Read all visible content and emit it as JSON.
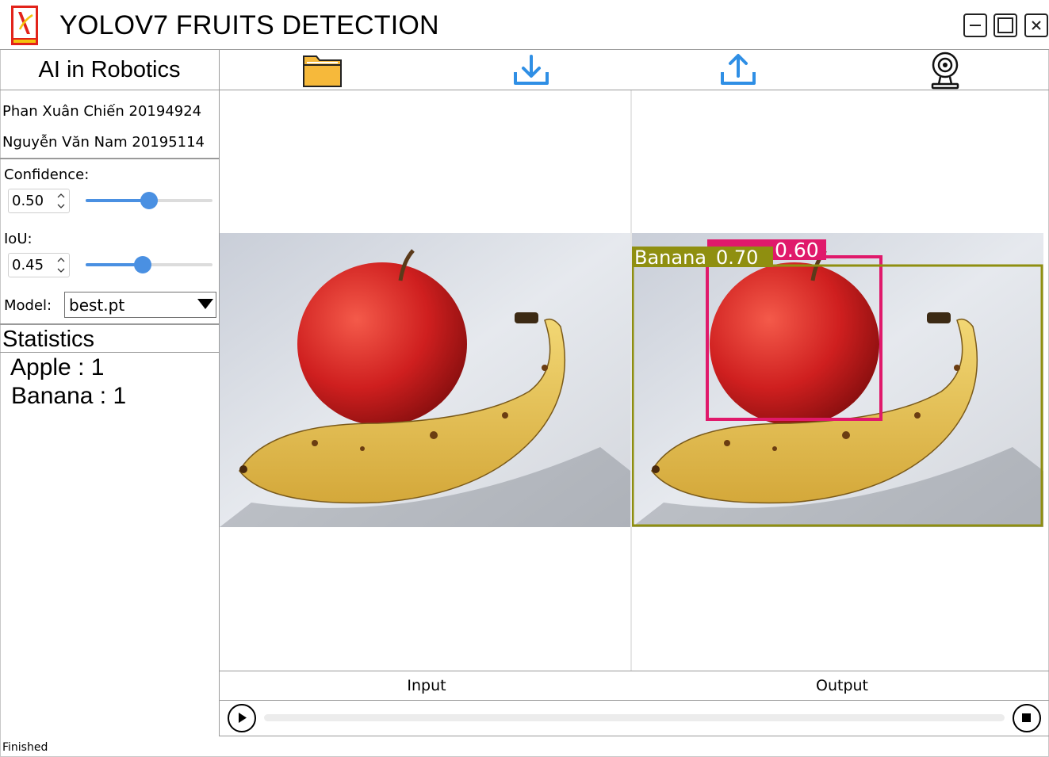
{
  "window": {
    "title": "YOLOV7 FRUITS DETECTION",
    "minimize_icon": "minimize-icon",
    "maximize_icon": "maximize-icon",
    "close_icon": "close-icon"
  },
  "sidebar": {
    "course": "AI in Robotics",
    "members": [
      "Phan Xuân Chiến 20194924",
      "Nguyễn Văn Nam 20195114"
    ],
    "confidence": {
      "label": "Confidence:",
      "value": "0.50",
      "level": 0.5
    },
    "iou": {
      "label": "IoU:",
      "value": "0.45",
      "level": 0.45
    },
    "model": {
      "label": "Model:",
      "value": "best.pt"
    },
    "statistics": {
      "title": "Statistics",
      "items": [
        {
          "name": "Apple",
          "sep": ":",
          "count": "1"
        },
        {
          "name": "Banana",
          "sep": ":",
          "count": "1"
        }
      ]
    }
  },
  "toolbar": {
    "items": [
      "folder-icon",
      "download-icon",
      "upload-icon",
      "webcam-icon"
    ],
    "colors": {
      "folder": "#f6b93b",
      "arrows": "#2f8fe5"
    }
  },
  "viewer": {
    "input_caption": "Input",
    "output_caption": "Output",
    "detections": [
      {
        "label": "Apple",
        "score": "0.60",
        "color": "#e0196b"
      },
      {
        "label": "Banana",
        "score": "0.70",
        "color": "#8f8f10"
      }
    ]
  },
  "player": {
    "play_icon": "play-icon",
    "stop_icon": "stop-icon",
    "progress": 0
  },
  "status": {
    "text": "Finished"
  },
  "colors": {
    "accent": "#4a90e2"
  }
}
